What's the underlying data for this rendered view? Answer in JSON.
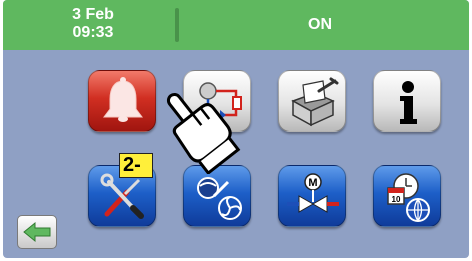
{
  "header": {
    "date": "3 Feb",
    "time": "09:33",
    "status": "ON",
    "color": "#5fb85f"
  },
  "menu": {
    "buttons": [
      {
        "icon": "alarm-bell-icon",
        "color": "#d12f22"
      },
      {
        "icon": "circuit-compressor-icon",
        "color": "#e4e4e4"
      },
      {
        "icon": "service-box-tools-icon",
        "color": "#e4e4e4"
      },
      {
        "icon": "info-icon",
        "color": "#e4e4e4"
      },
      {
        "icon": "settings-tools-icon",
        "color": "#1d5fc8"
      },
      {
        "icon": "compressor-fan-maintenance-icon",
        "color": "#1d5fc8"
      },
      {
        "icon": "motor-valve-icon",
        "color": "#1d5fc8"
      },
      {
        "icon": "calendar-clock-globe-icon",
        "color": "#1d5fc8"
      }
    ]
  },
  "navigation": {
    "back_icon": "back-arrow-icon"
  },
  "overlay": {
    "step_label": "2-",
    "pointer_icon": "pointing-hand-icon"
  }
}
